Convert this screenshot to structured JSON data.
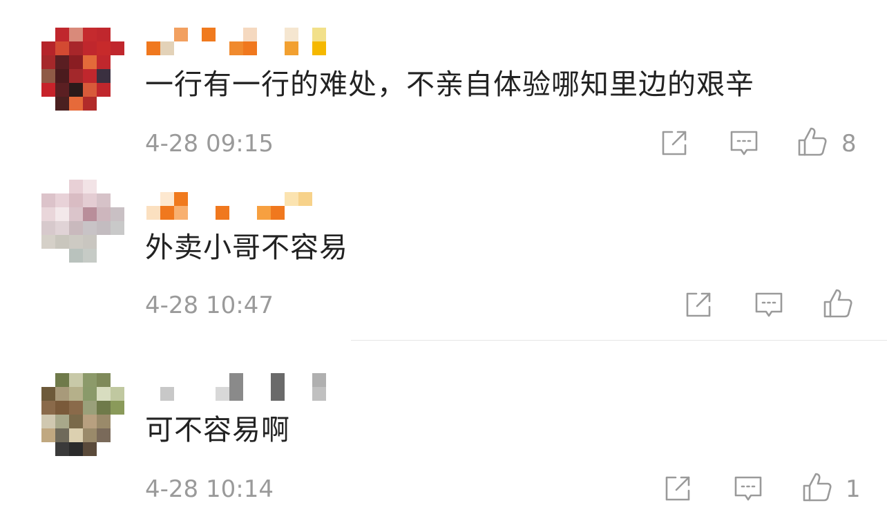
{
  "comments": [
    {
      "text": "一行有一行的难处，不亲自体验哪知里边的艰辛",
      "time": "4-28 09:15",
      "likes": "8",
      "avatar_colors": [
        "#ffffff",
        "#c0272d",
        "#d98a7a",
        "#c52a2e",
        "#c0272d",
        "#ffffff",
        "#b5242a",
        "#d34a32",
        "#a8262a",
        "#c0272d",
        "#c72a2b",
        "#c0272d",
        "#a6282a",
        "#5a1e22",
        "#8a1d22",
        "#e36a3a",
        "#c0272d",
        "#ffffff",
        "#8f5a46",
        "#4b1b1e",
        "#a3282b",
        "#c0272d",
        "#3a3040",
        "#ffffff",
        "#c7222a",
        "#5b1f22",
        "#2b1a1a",
        "#d85a3a",
        "#c0272d",
        "#ffffff",
        "#ffffff",
        "#4a2020",
        "#e66a3a",
        "#b12b2a",
        "#ffffff",
        "#ffffff"
      ],
      "name_colors": [
        "#ffffff",
        "#ffffff",
        "#f2a060",
        "#ffffff",
        "#f07a1e",
        "#ffffff",
        "#ffffff",
        "#f5d9c0",
        "#ffffff",
        "#ffffff",
        "#f5e6d0",
        "#ffffff",
        "#f2e08a",
        "#ffffff",
        "#f0781e",
        "#e3d2b8",
        "#ffffff",
        "#ffffff",
        "#ffffff",
        "#ffffff",
        "#f08a2e",
        "#f0781e",
        "#ffffff",
        "#ffffff",
        "#f2a030",
        "#ffffff",
        "#f5b800",
        "#ffffff"
      ]
    },
    {
      "text": "外卖小哥不容易",
      "time": "4-28 10:47",
      "likes": "",
      "avatar_colors": [
        "#ffffff",
        "#ffffff",
        "#e8d0d6",
        "#f2e3e6",
        "#ffffff",
        "#ffffff",
        "#dcc3ca",
        "#e8d2d8",
        "#d9bcc3",
        "#e4cdd3",
        "#d6c2c8",
        "#ffffff",
        "#e9d6da",
        "#f3e8ea",
        "#dbc5cb",
        "#b98e9a",
        "#cdb6bd",
        "#c9c0c4",
        "#d7c9cc",
        "#e0d3d6",
        "#c9b9bd",
        "#c8c3c6",
        "#c3bcc0",
        "#c9c9c9",
        "#d5d0c8",
        "#c9c6bd",
        "#cdcac3",
        "#c9c6c0",
        "#ffffff",
        "#ffffff",
        "#ffffff",
        "#ffffff",
        "#b9c2bd",
        "#c6cbc6",
        "#ffffff",
        "#ffffff"
      ],
      "name_colors": [
        "#ffffff",
        "#fde8d0",
        "#f07a1e",
        "#ffffff",
        "#ffffff",
        "#ffffff",
        "#ffffff",
        "#ffffff",
        "#ffffff",
        "#ffffff",
        "#fbe3b0",
        "#f7d28a",
        "#ffffff",
        "#ffffff",
        "#fbe0c0",
        "#f0781e",
        "#f8b070",
        "#ffffff",
        "#ffffff",
        "#f0781e",
        "#ffffff",
        "#ffffff",
        "#f7a040",
        "#f0781e",
        "#ffffff",
        "#ffffff",
        "#ffffff",
        "#ffffff"
      ]
    },
    {
      "text": "可不容易啊",
      "time": "4-28 10:14",
      "likes": "1",
      "avatar_colors": [
        "#ffffff",
        "#6f7a4a",
        "#c8c9a8",
        "#8c9a6a",
        "#7f8a5a",
        "#ffffff",
        "#6d5a3a",
        "#a89a7a",
        "#b5b08a",
        "#8a9a6a",
        "#d8ddc0",
        "#c0c8a0",
        "#8a6a4a",
        "#7a5a3a",
        "#8a6a4a",
        "#9aa07a",
        "#6f7a4a",
        "#8a9a5a",
        "#d0c8b0",
        "#a8a88a",
        "#7a6a4a",
        "#b8a080",
        "#9a8a6a",
        "#ffffff",
        "#c0a880",
        "#6f6a5a",
        "#dcd0b0",
        "#9a8a6a",
        "#7a6a5a",
        "#ffffff",
        "#ffffff",
        "#3a3a3a",
        "#2b2b2b",
        "#5a4a3a",
        "#ffffff",
        "#ffffff"
      ],
      "name_colors": [
        "#ffffff",
        "#ffffff",
        "#ffffff",
        "#ffffff",
        "#ffffff",
        "#ffffff",
        "#8a8a8a",
        "#ffffff",
        "#ffffff",
        "#6a6a6a",
        "#ffffff",
        "#ffffff",
        "#b0b0b0",
        "#ffffff",
        "#ffffff",
        "#c8c8c8",
        "#ffffff",
        "#ffffff",
        "#ffffff",
        "#d8d8d8",
        "#8a8a8a",
        "#ffffff",
        "#ffffff",
        "#6a6a6a",
        "#ffffff",
        "#ffffff",
        "#c0c0c0",
        "#ffffff"
      ]
    }
  ],
  "icon_names": {
    "share": "share-icon",
    "comment": "comment-icon",
    "like": "thumbs-up-icon"
  },
  "colors": {
    "text": "#222222",
    "meta": "#9a9a9a",
    "divider": "#e6e6e6"
  }
}
